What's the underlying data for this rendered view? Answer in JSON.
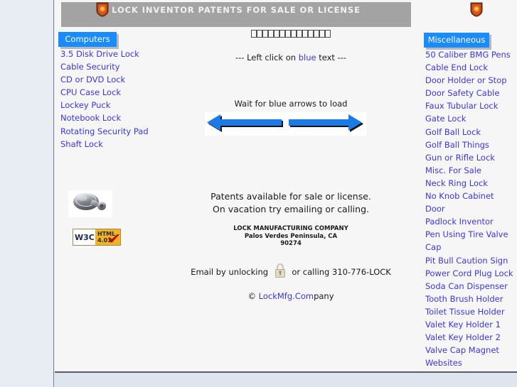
{
  "header": {
    "banner_title": "LOCK INVENTOR PATENTS FOR SALE OR LICENSE",
    "banner_color": "#a3a3a3",
    "banner_text_color": "#f2f2f2",
    "shield_left_icon": "shield-icon",
    "shield_right_icon": "shield-icon",
    "tofu_box_count": 14
  },
  "center": {
    "hint_prefix": "--- Left click on ",
    "hint_blue_word": "blue",
    "hint_suffix": " text ---",
    "wait_text": "Wait for blue arrows to load",
    "arrows_alt": "blue-arrows-image",
    "arrow_color": "#1a7ae8",
    "patents_line_1": "Patents available for sale or license.",
    "patents_line_2": "On vacation try emailing or calling.",
    "company_name": "LOCK MANUFACTURING COMPANY",
    "company_city": "Palos Verdes Peninsula, CA",
    "company_zip": "90274",
    "email_prefix": "Email by unlocking",
    "email_suffix": "or calling 310-776-LOCK",
    "padlock_icon": "padlock-icon",
    "copyright_symbol": "© ",
    "copyright_link": "LockMfg.Com",
    "copyright_tail": "pany"
  },
  "left_nav": {
    "button_label": "Computers",
    "button_color": "#1a8cff",
    "link_color": "#3b37e0",
    "items": [
      "3.5 Disk Drive Lock",
      "Cable Security",
      "CD or DVD Lock",
      "CPU Case Lock",
      "Lockey Puck",
      "Notebook Lock",
      "Rotating Security Pad",
      "Shaft Lock"
    ]
  },
  "right_nav": {
    "button_label": "Miscellaneous",
    "button_color": "#1a8cff",
    "link_color": "#3b37e0",
    "items": [
      "50 Caliber BMG Pens",
      "Cable End Lock",
      "Door Holder or Stop",
      "Door Safety Cable",
      "Faux Tubular Lock",
      "Gate Lock",
      "Golf Ball Lock",
      "Golf Ball Things",
      "Gun or Rifle Lock",
      "Misc. For Sale",
      "Neck Ring Lock",
      "No Knob Cabinet Door",
      "Padlock Inventor",
      "Pen Using Tire Valve Cap",
      "Pit Bull Caution Sign",
      "Power Cord Plug Lock",
      "Soda Can Dispenser",
      "Tooth Brush Holder",
      "Toilet Tissue Holder",
      "Valet Key Holder 1",
      "Valet Key Holder 2",
      "Valve Cap Magnet",
      "Websites"
    ]
  },
  "sidebar_media": {
    "lock_image_alt": "metallic-lock-image",
    "w3c_mark": "W3C",
    "w3c_html_label": "HTML",
    "w3c_version_label": "4.01",
    "w3c_badge_color": "#f0b323"
  }
}
